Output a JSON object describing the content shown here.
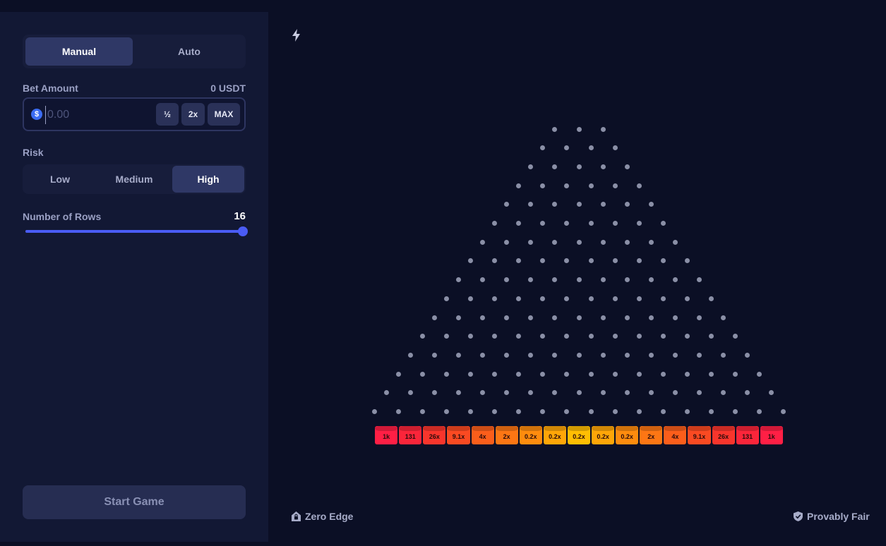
{
  "mode_tabs": [
    {
      "label": "Manual",
      "active": true
    },
    {
      "label": "Auto",
      "active": false
    }
  ],
  "bet": {
    "label": "Bet Amount",
    "balance": "0 USDT",
    "currency_icon": "$",
    "placeholder": "0.00",
    "half_label": "½",
    "double_label": "2x",
    "max_label": "MAX"
  },
  "risk": {
    "label": "Risk",
    "options": [
      "Low",
      "Medium",
      "High"
    ],
    "selected": "High"
  },
  "rows": {
    "label": "Number of Rows",
    "value": "16",
    "min": 8,
    "max": 16
  },
  "start_label": "Start Game",
  "buckets": [
    {
      "label": "1k",
      "color": "#ff1f45"
    },
    {
      "label": "131",
      "color": "#fa253a"
    },
    {
      "label": "26x",
      "color": "#f8352c"
    },
    {
      "label": "9.1x",
      "color": "#fa4a22"
    },
    {
      "label": "4x",
      "color": "#fb5e1b"
    },
    {
      "label": "2x",
      "color": "#fd7614"
    },
    {
      "label": "0.2x",
      "color": "#fe8c0e"
    },
    {
      "label": "0.2x",
      "color": "#ffa608"
    },
    {
      "label": "0.2x",
      "color": "#ffbe03"
    },
    {
      "label": "0.2x",
      "color": "#ffa608"
    },
    {
      "label": "0.2x",
      "color": "#fe8c0e"
    },
    {
      "label": "2x",
      "color": "#fd7614"
    },
    {
      "label": "4x",
      "color": "#fb5e1b"
    },
    {
      "label": "9.1x",
      "color": "#fa4a22"
    },
    {
      "label": "26x",
      "color": "#f8352c"
    },
    {
      "label": "131",
      "color": "#fa253a"
    },
    {
      "label": "1k",
      "color": "#ff1f45"
    }
  ],
  "footer": {
    "zero_edge": "Zero Edge",
    "provably_fair": "Provably Fair"
  },
  "icons": [
    "lightning-icon",
    "dollar-coin-icon",
    "house-lock-icon",
    "shield-check-icon"
  ]
}
